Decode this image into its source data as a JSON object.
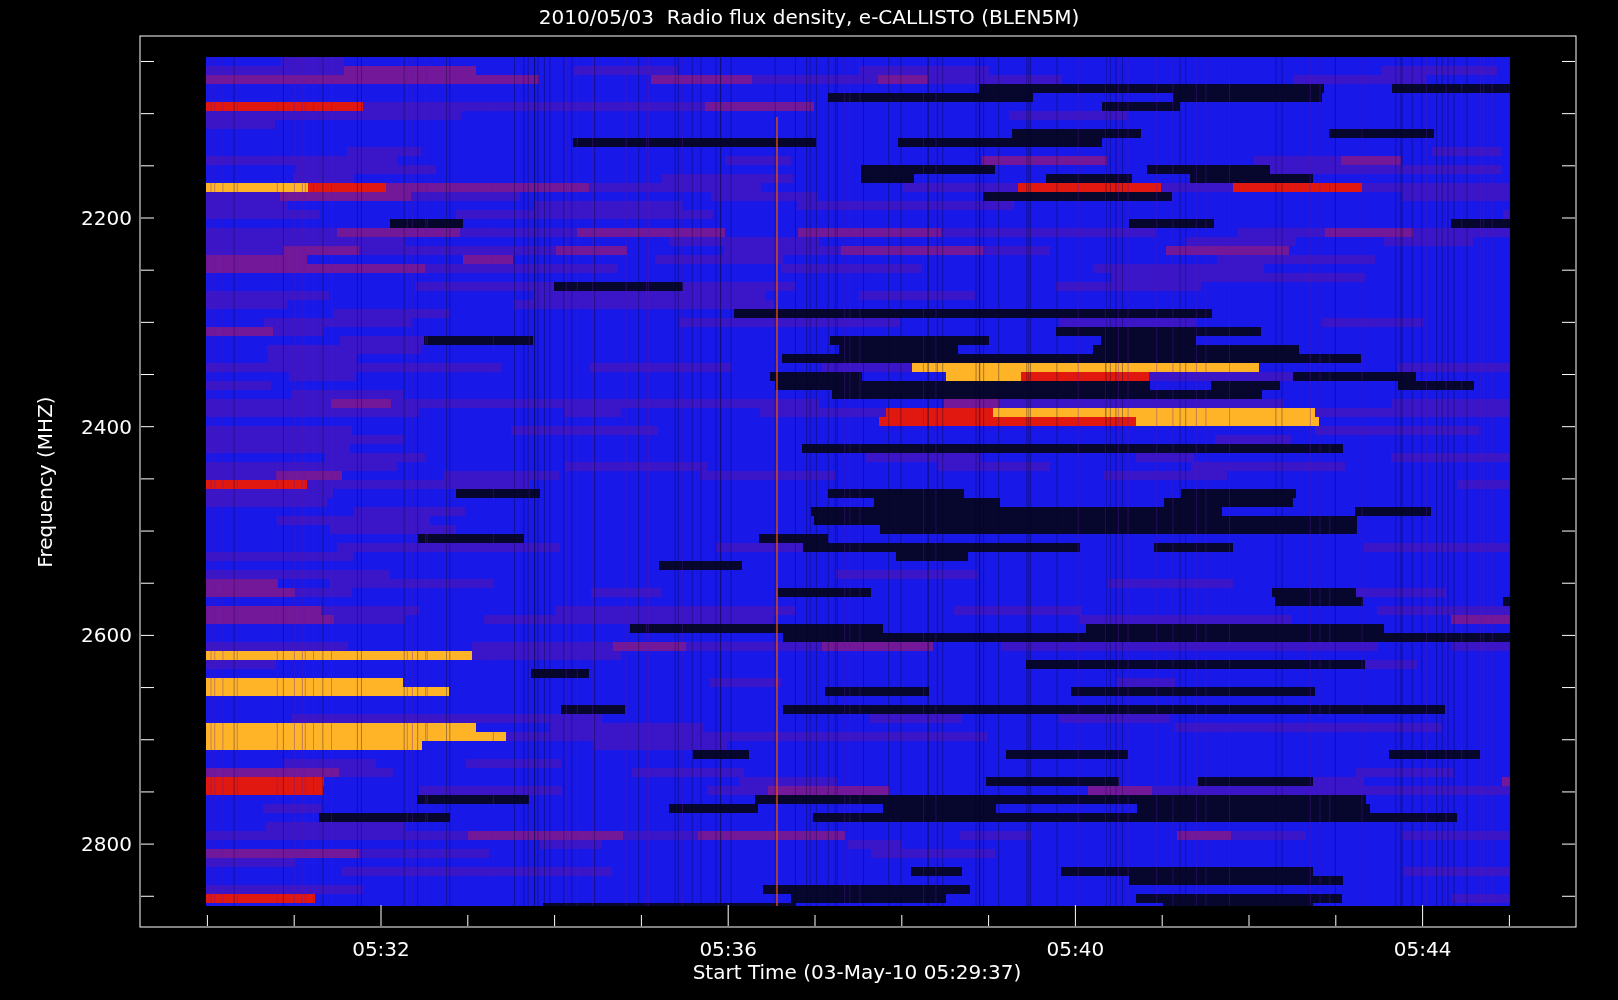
{
  "plot": {
    "title": "2010/05/03  Radio flux density, e-CALLISTO (BLEN5M)",
    "xlabel": "Start Time (03-May-10 05:29:37)",
    "ylabel": "Frequency (MHZ)",
    "yticks": [
      "2200",
      "2400",
      "2600",
      "2800"
    ],
    "xticks": [
      "05:32",
      "05:36",
      "05:40",
      "05:44"
    ]
  }
}
